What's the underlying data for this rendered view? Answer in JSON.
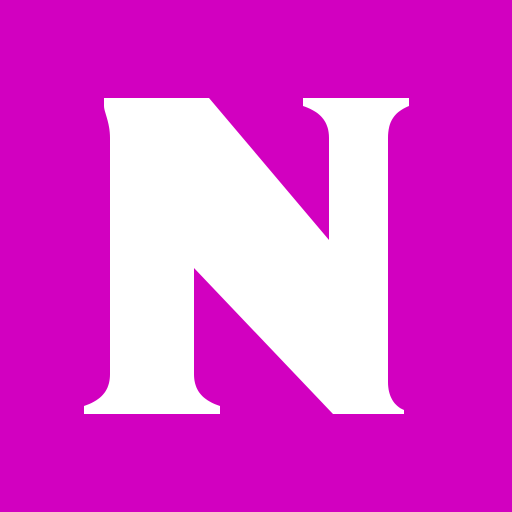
{
  "logo": {
    "letter": "N",
    "background_color": "#d200c0",
    "letter_color": "#ffffff"
  }
}
